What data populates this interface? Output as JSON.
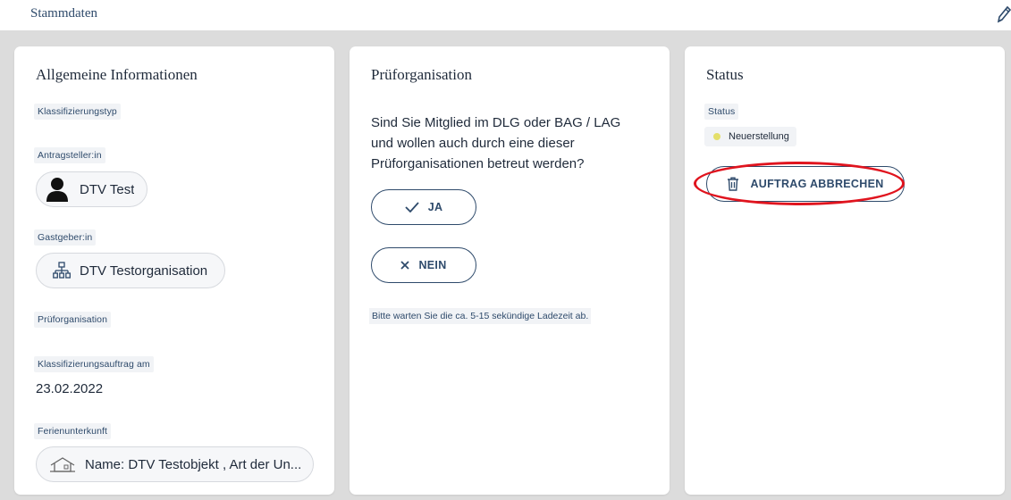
{
  "header": {
    "title": "Stammdaten",
    "edit_icon": "pencil-icon"
  },
  "cards": {
    "general": {
      "title": "Allgemeine Informationen",
      "fields": {
        "klassifizierungstyp": {
          "label": "Klassifizierungstyp"
        },
        "antragsteller": {
          "label": "Antragsteller:in",
          "value": "DTV Test",
          "icon": "person-icon"
        },
        "gastgeber": {
          "label": "Gastgeber:in",
          "value": "DTV Testorganisation",
          "icon": "org-chart-icon"
        },
        "pruforganisation": {
          "label": "Prüforganisation"
        },
        "auftrag_am": {
          "label": "Klassifizierungsauftrag am",
          "value": "23.02.2022"
        },
        "ferienunterkunft": {
          "label": "Ferienunterkunft",
          "value": "Name: DTV Testobjekt , Art der Un...",
          "icon": "house-icon"
        }
      }
    },
    "pruforg": {
      "title": "Prüforganisation",
      "question": "Sind Sie Mitglied im DLG oder BAG / LAG und wollen auch durch eine dieser Prüforganisationen betreut werden?",
      "yes_label": "JA",
      "no_label": "NEIN",
      "hint": "Bitte warten Sie die ca. 5-15 sekündige Ladezeit ab."
    },
    "status": {
      "title": "Status",
      "status_label": "Status",
      "status_value": "Neuerstellung",
      "status_color": "#e4df6a",
      "cancel_label": "AUFTRAG ABBRECHEN",
      "highlight_color": "#e0141e"
    }
  },
  "colors": {
    "accent": "#2e4a6b",
    "background": "#dcdcdc"
  }
}
